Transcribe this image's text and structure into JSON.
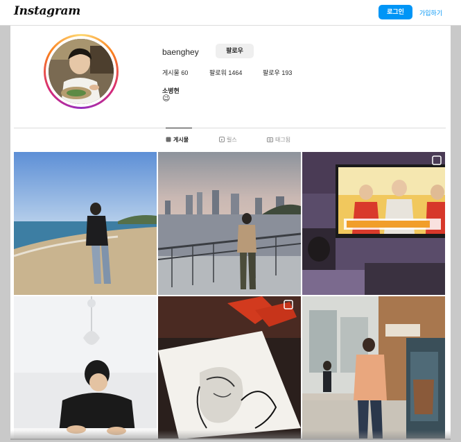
{
  "header": {
    "logo": "Instagram",
    "login_label": "로그인",
    "signup_label": "가입하기"
  },
  "profile": {
    "username": "baenghey",
    "follow_label": "팔로우",
    "stats": {
      "posts": "게시물 60",
      "followers": "팔로워 1464",
      "following": "팔로우 193"
    },
    "full_name": "소병현",
    "bio_emoji": "😉"
  },
  "tabs": [
    {
      "label": "게시물",
      "icon": "grid-icon",
      "active": true
    },
    {
      "label": "릴스",
      "icon": "reels-icon",
      "active": false
    },
    {
      "label": "태그됨",
      "icon": "tagged-icon",
      "active": false
    }
  ],
  "colors": {
    "accent": "#0095f6",
    "text": "#262626",
    "muted": "#8e8e8e",
    "border": "#dbdbdb"
  }
}
